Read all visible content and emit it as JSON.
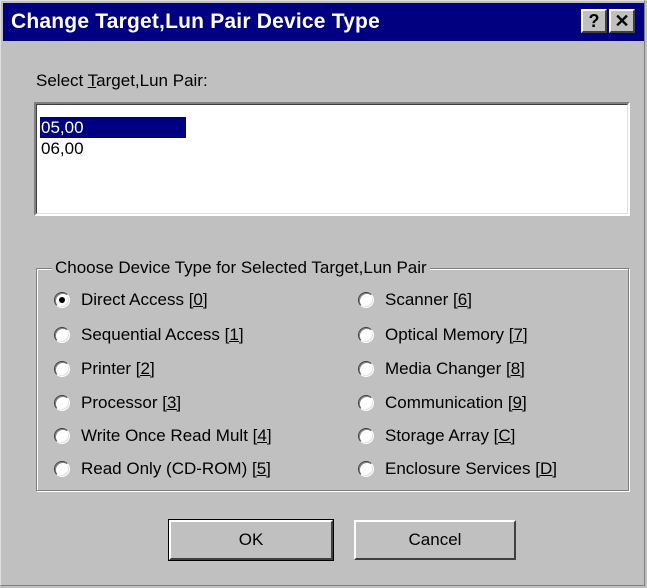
{
  "window": {
    "title": "Change Target,Lun Pair Device Type",
    "help_button": "?",
    "close_button": "✕"
  },
  "target_lun": {
    "label_pre": "Select ",
    "label_accel": "T",
    "label_post": "arget,Lun Pair:",
    "items": [
      {
        "label": "05,00",
        "selected": true
      },
      {
        "label": "06,00",
        "selected": false
      }
    ]
  },
  "device_type": {
    "legend": "Choose Device Type for Selected Target,Lun Pair",
    "options": [
      {
        "name": "Direct Access ",
        "key": "[0]",
        "checked": true
      },
      {
        "name": "Sequential Access ",
        "key": "[1]",
        "checked": false
      },
      {
        "name": "Printer ",
        "key": "[2]",
        "checked": false
      },
      {
        "name": "Processor ",
        "key": "[3]",
        "checked": false
      },
      {
        "name": "Write Once Read Mult ",
        "key": "[4]",
        "checked": false
      },
      {
        "name": "Read Only (CD-ROM) ",
        "key": "[5]",
        "checked": false
      },
      {
        "name": "Scanner ",
        "key": "[6]",
        "checked": false
      },
      {
        "name": "Optical Memory ",
        "key": "[7]",
        "checked": false
      },
      {
        "name": "Media Changer ",
        "key": "[8]",
        "checked": false
      },
      {
        "name": "Communication ",
        "key": "[9]",
        "checked": false
      },
      {
        "name": "Storage Array ",
        "key": "[C]",
        "checked": false
      },
      {
        "name": "Enclosure Services ",
        "key": "[D]",
        "checked": false
      }
    ]
  },
  "buttons": {
    "ok": "OK",
    "cancel": "Cancel"
  }
}
